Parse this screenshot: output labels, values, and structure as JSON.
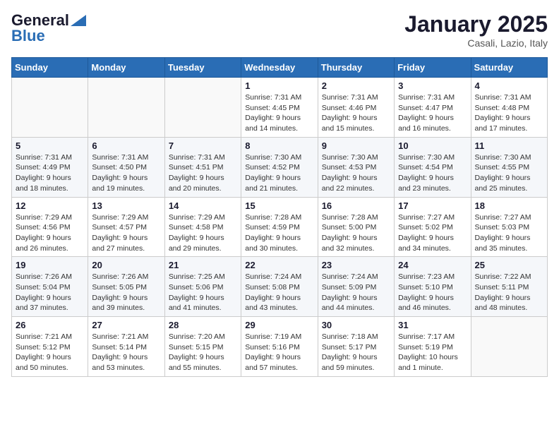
{
  "logo": {
    "general": "General",
    "blue": "Blue"
  },
  "title": "January 2025",
  "location": "Casali, Lazio, Italy",
  "days_header": [
    "Sunday",
    "Monday",
    "Tuesday",
    "Wednesday",
    "Thursday",
    "Friday",
    "Saturday"
  ],
  "weeks": [
    [
      {
        "num": "",
        "info": ""
      },
      {
        "num": "",
        "info": ""
      },
      {
        "num": "",
        "info": ""
      },
      {
        "num": "1",
        "info": "Sunrise: 7:31 AM\nSunset: 4:45 PM\nDaylight: 9 hours\nand 14 minutes."
      },
      {
        "num": "2",
        "info": "Sunrise: 7:31 AM\nSunset: 4:46 PM\nDaylight: 9 hours\nand 15 minutes."
      },
      {
        "num": "3",
        "info": "Sunrise: 7:31 AM\nSunset: 4:47 PM\nDaylight: 9 hours\nand 16 minutes."
      },
      {
        "num": "4",
        "info": "Sunrise: 7:31 AM\nSunset: 4:48 PM\nDaylight: 9 hours\nand 17 minutes."
      }
    ],
    [
      {
        "num": "5",
        "info": "Sunrise: 7:31 AM\nSunset: 4:49 PM\nDaylight: 9 hours\nand 18 minutes."
      },
      {
        "num": "6",
        "info": "Sunrise: 7:31 AM\nSunset: 4:50 PM\nDaylight: 9 hours\nand 19 minutes."
      },
      {
        "num": "7",
        "info": "Sunrise: 7:31 AM\nSunset: 4:51 PM\nDaylight: 9 hours\nand 20 minutes."
      },
      {
        "num": "8",
        "info": "Sunrise: 7:30 AM\nSunset: 4:52 PM\nDaylight: 9 hours\nand 21 minutes."
      },
      {
        "num": "9",
        "info": "Sunrise: 7:30 AM\nSunset: 4:53 PM\nDaylight: 9 hours\nand 22 minutes."
      },
      {
        "num": "10",
        "info": "Sunrise: 7:30 AM\nSunset: 4:54 PM\nDaylight: 9 hours\nand 23 minutes."
      },
      {
        "num": "11",
        "info": "Sunrise: 7:30 AM\nSunset: 4:55 PM\nDaylight: 9 hours\nand 25 minutes."
      }
    ],
    [
      {
        "num": "12",
        "info": "Sunrise: 7:29 AM\nSunset: 4:56 PM\nDaylight: 9 hours\nand 26 minutes."
      },
      {
        "num": "13",
        "info": "Sunrise: 7:29 AM\nSunset: 4:57 PM\nDaylight: 9 hours\nand 27 minutes."
      },
      {
        "num": "14",
        "info": "Sunrise: 7:29 AM\nSunset: 4:58 PM\nDaylight: 9 hours\nand 29 minutes."
      },
      {
        "num": "15",
        "info": "Sunrise: 7:28 AM\nSunset: 4:59 PM\nDaylight: 9 hours\nand 30 minutes."
      },
      {
        "num": "16",
        "info": "Sunrise: 7:28 AM\nSunset: 5:00 PM\nDaylight: 9 hours\nand 32 minutes."
      },
      {
        "num": "17",
        "info": "Sunrise: 7:27 AM\nSunset: 5:02 PM\nDaylight: 9 hours\nand 34 minutes."
      },
      {
        "num": "18",
        "info": "Sunrise: 7:27 AM\nSunset: 5:03 PM\nDaylight: 9 hours\nand 35 minutes."
      }
    ],
    [
      {
        "num": "19",
        "info": "Sunrise: 7:26 AM\nSunset: 5:04 PM\nDaylight: 9 hours\nand 37 minutes."
      },
      {
        "num": "20",
        "info": "Sunrise: 7:26 AM\nSunset: 5:05 PM\nDaylight: 9 hours\nand 39 minutes."
      },
      {
        "num": "21",
        "info": "Sunrise: 7:25 AM\nSunset: 5:06 PM\nDaylight: 9 hours\nand 41 minutes."
      },
      {
        "num": "22",
        "info": "Sunrise: 7:24 AM\nSunset: 5:08 PM\nDaylight: 9 hours\nand 43 minutes."
      },
      {
        "num": "23",
        "info": "Sunrise: 7:24 AM\nSunset: 5:09 PM\nDaylight: 9 hours\nand 44 minutes."
      },
      {
        "num": "24",
        "info": "Sunrise: 7:23 AM\nSunset: 5:10 PM\nDaylight: 9 hours\nand 46 minutes."
      },
      {
        "num": "25",
        "info": "Sunrise: 7:22 AM\nSunset: 5:11 PM\nDaylight: 9 hours\nand 48 minutes."
      }
    ],
    [
      {
        "num": "26",
        "info": "Sunrise: 7:21 AM\nSunset: 5:12 PM\nDaylight: 9 hours\nand 50 minutes."
      },
      {
        "num": "27",
        "info": "Sunrise: 7:21 AM\nSunset: 5:14 PM\nDaylight: 9 hours\nand 53 minutes."
      },
      {
        "num": "28",
        "info": "Sunrise: 7:20 AM\nSunset: 5:15 PM\nDaylight: 9 hours\nand 55 minutes."
      },
      {
        "num": "29",
        "info": "Sunrise: 7:19 AM\nSunset: 5:16 PM\nDaylight: 9 hours\nand 57 minutes."
      },
      {
        "num": "30",
        "info": "Sunrise: 7:18 AM\nSunset: 5:17 PM\nDaylight: 9 hours\nand 59 minutes."
      },
      {
        "num": "31",
        "info": "Sunrise: 7:17 AM\nSunset: 5:19 PM\nDaylight: 10 hours\nand 1 minute."
      },
      {
        "num": "",
        "info": ""
      }
    ]
  ]
}
